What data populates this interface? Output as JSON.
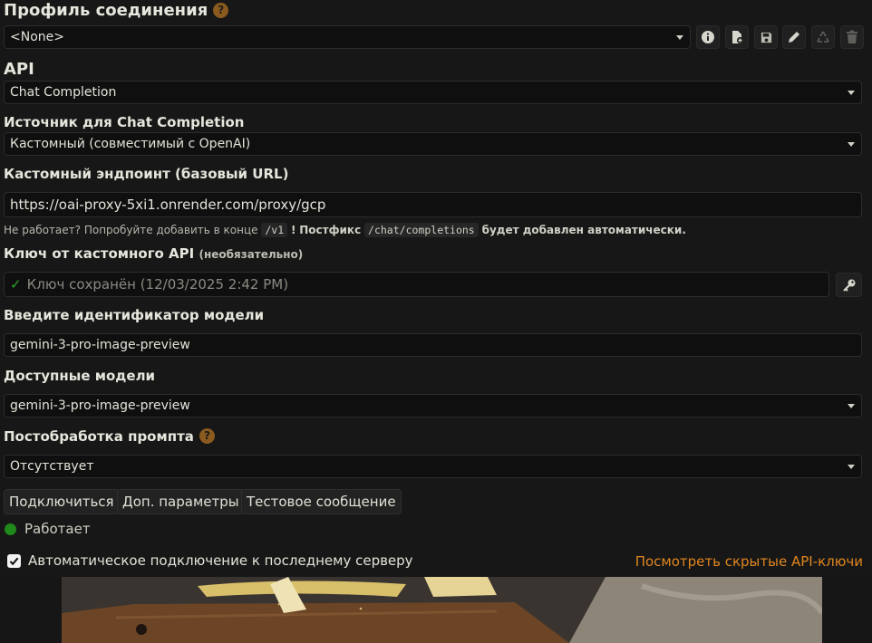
{
  "profile": {
    "title": "Профиль соединения",
    "help": "?",
    "selected": "<None>",
    "icons": [
      "info-icon",
      "new-file-icon",
      "save-icon",
      "edit-icon",
      "recycle-icon",
      "trash-icon"
    ]
  },
  "api": {
    "label": "API",
    "selected": "Chat Completion"
  },
  "source": {
    "label": "Источник для Chat Completion",
    "selected": "Кастомный (совместимый с OpenAI)"
  },
  "endpoint": {
    "label": "Кастомный эндпоинт (базовый URL)",
    "value": "https://oai-proxy-5xi1.onrender.com/proxy/gcp",
    "note_prefix": "Не работает? Попробуйте добавить в конце",
    "note_code1": "/v1",
    "note_bang": "!",
    "note_bold": "Постфикс",
    "note_code2": "/chat/completions",
    "note_suffix": "будет добавлен автоматически."
  },
  "key": {
    "label": "Ключ от кастомного API",
    "optional": "(необязательно)",
    "status": "Ключ сохранён (12/03/2025 2:42 PM)"
  },
  "model_id": {
    "label": "Введите идентификатор модели",
    "value": "gemini-3-pro-image-preview"
  },
  "models": {
    "label": "Доступные модели",
    "selected": "gemini-3-pro-image-preview"
  },
  "postprocess": {
    "label": "Постобработка промпта",
    "help": "?",
    "selected": "Отсутствует"
  },
  "buttons": {
    "connect": "Подключиться",
    "extra": "Доп. параметры",
    "test": "Тестовое сообщение"
  },
  "status": {
    "text": "Работает",
    "color": "#1f8a1a"
  },
  "autoconnect": {
    "label": "Автоматическое подключение к последнему серверу",
    "checked": true
  },
  "hidden_keys_link": "Посмотреть скрытые API-ключи",
  "colors": {
    "accent": "#e0861f",
    "help_badge": "#8a5a1e"
  }
}
